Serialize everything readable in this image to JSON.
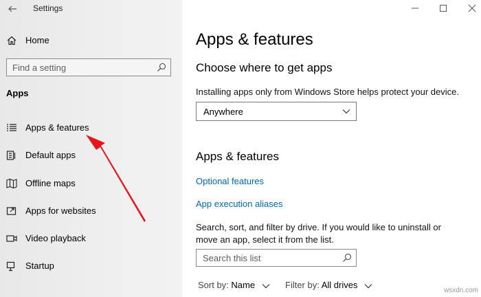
{
  "window": {
    "title": "Settings"
  },
  "sidebar": {
    "home_label": "Home",
    "search_placeholder": "Find a setting",
    "section_heading": "Apps",
    "items": [
      {
        "label": "Apps & features",
        "icon": "list-icon"
      },
      {
        "label": "Default apps",
        "icon": "default-apps-icon"
      },
      {
        "label": "Offline maps",
        "icon": "map-icon"
      },
      {
        "label": "Apps for websites",
        "icon": "link-window-icon"
      },
      {
        "label": "Video playback",
        "icon": "video-icon"
      },
      {
        "label": "Startup",
        "icon": "startup-icon"
      }
    ]
  },
  "main": {
    "page_title": "Apps & features",
    "choose_heading": "Choose where to get apps",
    "choose_description": "Installing apps only from Windows Store helps protect your device.",
    "source_dropdown_value": "Anywhere",
    "apps_heading": "Apps & features",
    "links": [
      "Optional features",
      "App execution aliases"
    ],
    "filter_description": "Search, sort, and filter by drive. If you would like to uninstall or move an app, select it from the list.",
    "search_placeholder": "Search this list",
    "sort_key": "Sort by:",
    "sort_value": "Name",
    "filter_key": "Filter by:",
    "filter_value": "All drives"
  },
  "watermark": "wsxdn.com",
  "colors": {
    "accent_link": "#0067b8",
    "annotation_arrow": "#e8141b",
    "sidebar_bg": "#ececec"
  }
}
